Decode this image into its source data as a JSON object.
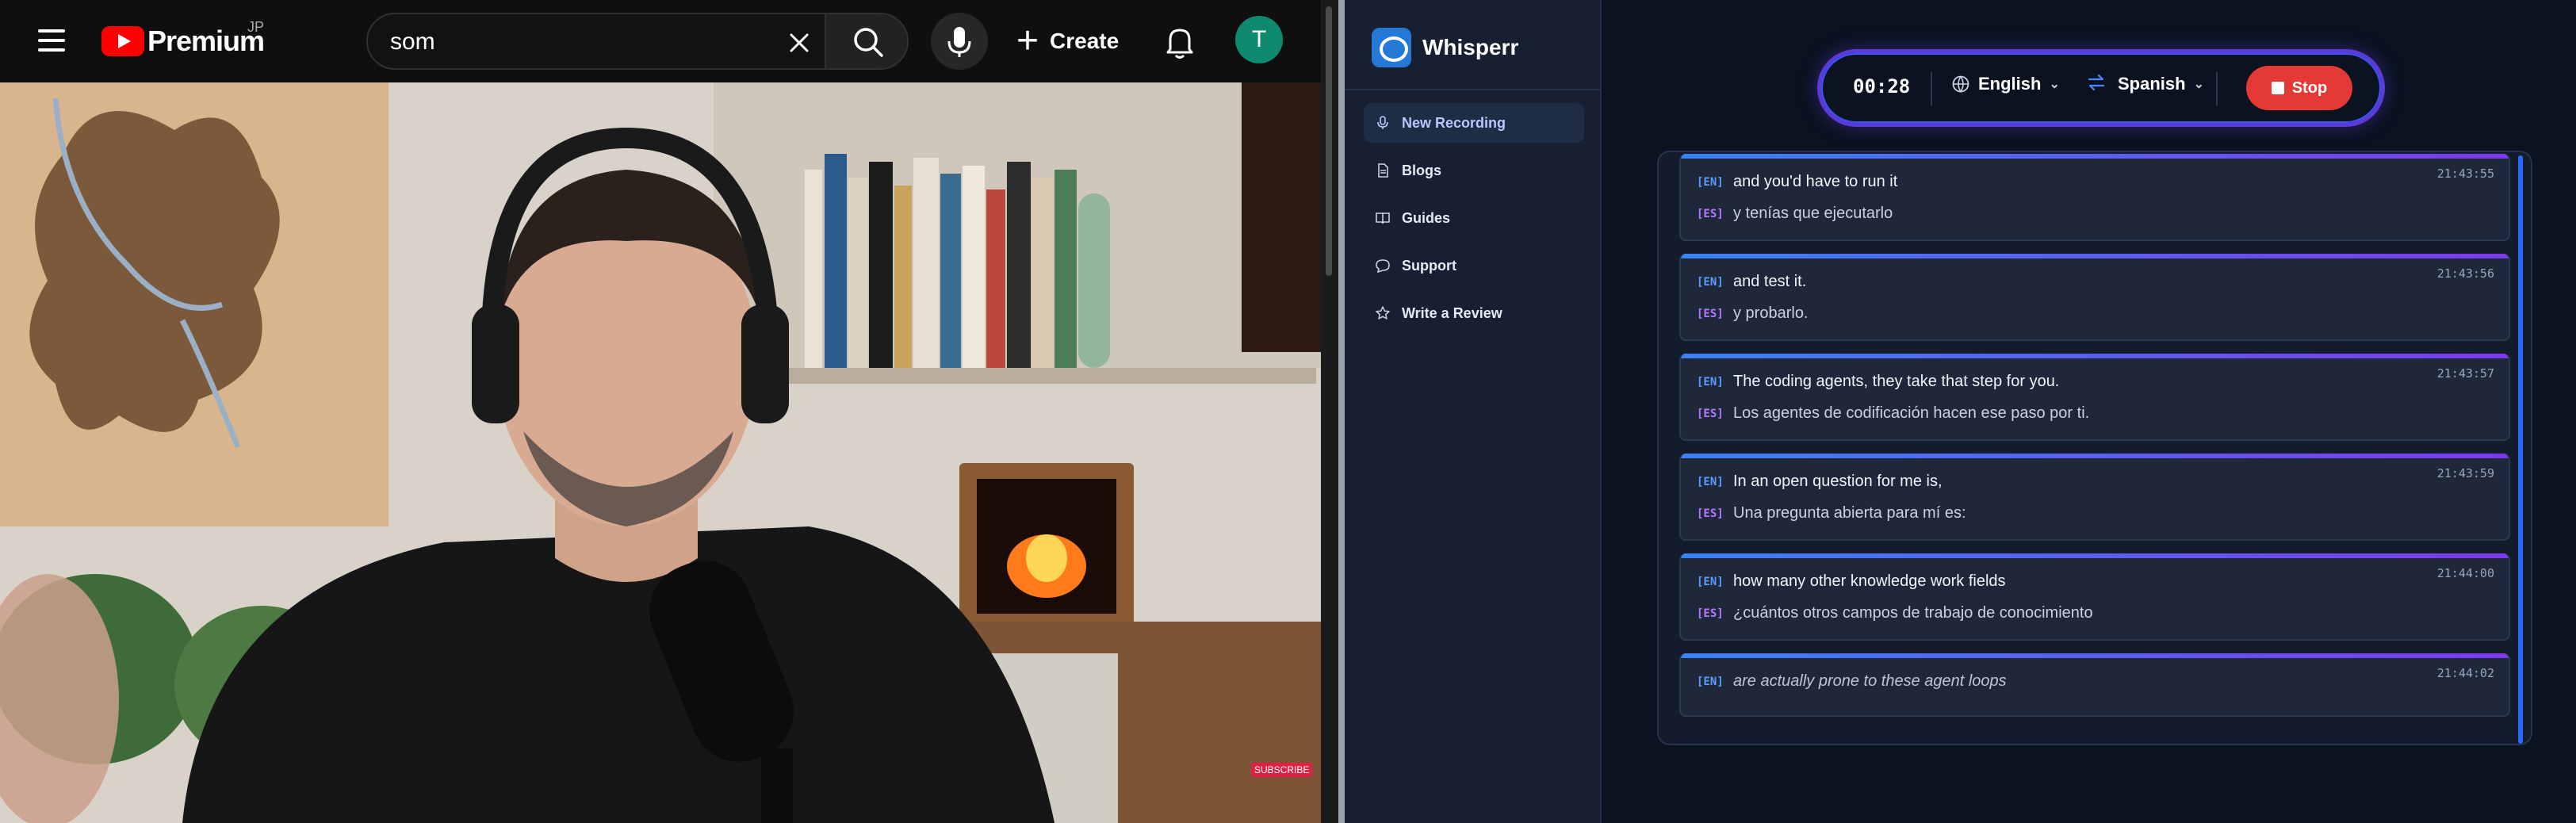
{
  "youtube": {
    "logo_text": "Premium",
    "region": "JP",
    "search_query": "som",
    "create_label": "Create",
    "avatar_initial": "T",
    "subscribe_watermark": "SUBSCRIBE"
  },
  "whisperr": {
    "app_name": "Whisperr",
    "nav": [
      {
        "label": "New Recording",
        "icon": "mic-icon"
      },
      {
        "label": "Blogs",
        "icon": "document-icon"
      },
      {
        "label": "Guides",
        "icon": "book-icon"
      },
      {
        "label": "Support",
        "icon": "chat-icon"
      },
      {
        "label": "Write a Review",
        "icon": "star-icon"
      }
    ],
    "controls": {
      "timer": "00:28",
      "source_language": "English",
      "target_language": "Spanish",
      "stop_label": "Stop"
    },
    "colors": {
      "accent_blue": "#3b82f6",
      "accent_purple": "#7c3aed",
      "stop_red": "#e53935"
    },
    "transcript": [
      {
        "time": "21:43:55",
        "en_tag": "[EN]",
        "en": "and you'd have to run it",
        "es_tag": "[ES]",
        "es": "y tenías que ejecutarlo"
      },
      {
        "time": "21:43:56",
        "en_tag": "[EN]",
        "en": "and test it.",
        "es_tag": "[ES]",
        "es": "y probarlo."
      },
      {
        "time": "21:43:57",
        "en_tag": "[EN]",
        "en": "The coding agents, they take that step for you.",
        "es_tag": "[ES]",
        "es": "Los agentes de codificación hacen ese paso por ti."
      },
      {
        "time": "21:43:59",
        "en_tag": "[EN]",
        "en": "In an open question for me is,",
        "es_tag": "[ES]",
        "es": "Una pregunta abierta para mí es:"
      },
      {
        "time": "21:44:00",
        "en_tag": "[EN]",
        "en": "how many other knowledge work fields",
        "es_tag": "[ES]",
        "es": "¿cuántos otros campos de trabajo de conocimiento"
      },
      {
        "time": "21:44:02",
        "en_tag": "[EN]",
        "en": "are actually prone to these agent loops",
        "es_tag": "",
        "es": ""
      }
    ]
  }
}
